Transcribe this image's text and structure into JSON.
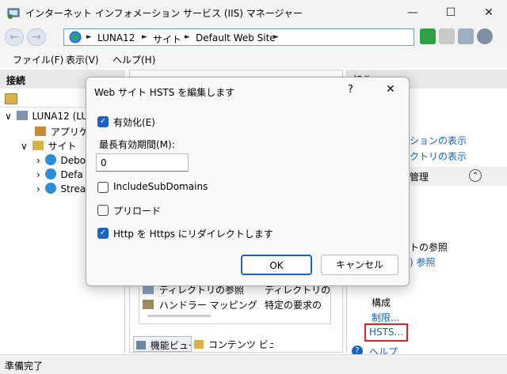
{
  "window": {
    "title": "インターネット インフォメーション サービス (IIS) マネージャー",
    "minimize": "—",
    "maximize": "☐",
    "close": "✕"
  },
  "nav": {
    "back": "←",
    "forward": "→",
    "breadcrumbs": [
      "LUNA12",
      "サイト",
      "Default Web Site"
    ],
    "arrow": "►"
  },
  "menu": [
    "ファイル(F)",
    "表示(V)",
    "ヘルプ(H)"
  ],
  "connections": {
    "header": "接続",
    "tree": [
      {
        "label": "LUNA12 (LU",
        "expander": "∨"
      },
      {
        "label": "アプリケーシ",
        "expander": ""
      },
      {
        "label": "サイト",
        "expander": "∨"
      },
      {
        "label": "Debo",
        "expander": "›"
      },
      {
        "label": "Defa",
        "expander": "›"
      },
      {
        "label": "Strea",
        "expander": "›"
      }
    ]
  },
  "features": {
    "rows": [
      {
        "name": "ディレクトリの参照",
        "desc": "ディレクトリの一"
      },
      {
        "name": "ハンドラー マッピング",
        "desc": "特定の要求の"
      }
    ],
    "view_tabs": [
      "機能ビュー",
      "コンテンツ ビュー"
    ]
  },
  "actions": {
    "header": "操作",
    "items": [
      "ションの表示",
      "クトリの表示",
      "管理",
      "トの参照",
      ") 参照"
    ],
    "config_header": "構成",
    "limits": "制限...",
    "hsts": "HSTS...",
    "help": "ヘルプ",
    "collapse": "⌃"
  },
  "status": "準備完了",
  "dialog": {
    "title": "Web サイト HSTS を編集します",
    "help": "?",
    "close": "✕",
    "enabled_label": "有効化(E)",
    "enabled": true,
    "max_age_label": "最長有効期間(M):",
    "max_age_value": "0",
    "include_subdomains_label": "IncludeSubDomains",
    "include_subdomains": false,
    "preload_label": "プリロード",
    "preload": false,
    "redirect_label": "Http を Https にリダイレクトします",
    "redirect": true,
    "check_mark": "✓",
    "ok": "OK",
    "cancel": "キャンセル"
  },
  "colors": {
    "accent": "#1a63c4",
    "link": "#1160b8",
    "highlight": "#d6232e"
  }
}
